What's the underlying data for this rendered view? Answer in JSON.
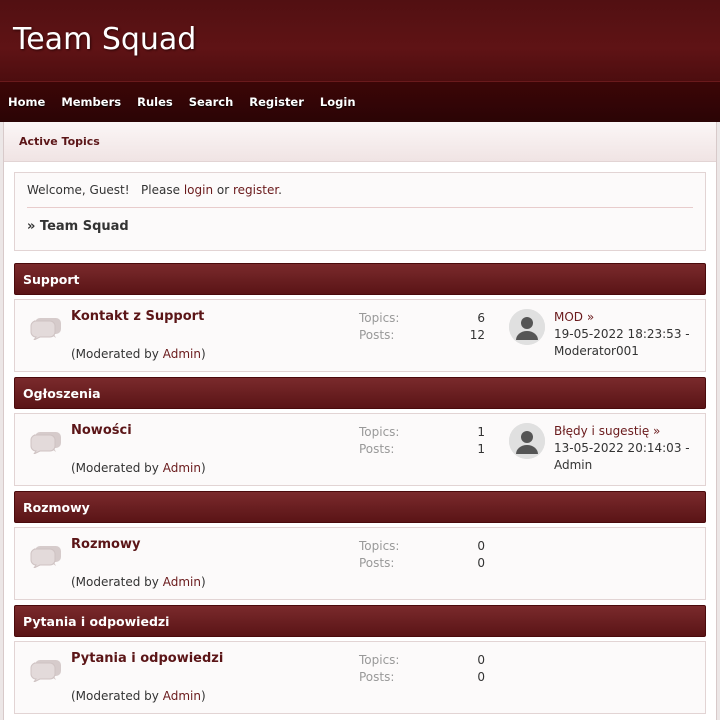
{
  "site": {
    "title": "Team Squad"
  },
  "nav": [
    "Home",
    "Members",
    "Rules",
    "Search",
    "Register",
    "Login"
  ],
  "breadcrumb_bar": {
    "active_topics": "Active Topics"
  },
  "welcome": {
    "greeting": "Welcome, Guest!",
    "please": "Please",
    "login": "login",
    "or": "or",
    "register": "register",
    "crumb": "» Team Squad"
  },
  "categories": [
    {
      "name": "Support",
      "board": {
        "name": "Kontakt z Support",
        "moderated_prefix": "(Moderated by ",
        "moderator": "Admin",
        "moderated_suffix": ")",
        "topics_label": "Topics:",
        "topics": "6",
        "posts_label": "Posts:",
        "posts": "12",
        "last_title": "MOD »",
        "last_date": "19-05-2022 18:23:53 -",
        "last_user": "Moderator001"
      }
    },
    {
      "name": "Ogłoszenia",
      "board": {
        "name": "Nowości",
        "moderated_prefix": "(Moderated by ",
        "moderator": "Admin",
        "moderated_suffix": ")",
        "topics_label": "Topics:",
        "topics": "1",
        "posts_label": "Posts:",
        "posts": "1",
        "last_title": "Błędy i sugestię »",
        "last_date": "13-05-2022 20:14:03 -",
        "last_user": "Admin"
      }
    },
    {
      "name": "Rozmowy",
      "board": {
        "name": "Rozmowy",
        "moderated_prefix": "(Moderated by ",
        "moderator": "Admin",
        "moderated_suffix": ")",
        "topics_label": "Topics:",
        "topics": "0",
        "posts_label": "Posts:",
        "posts": "0"
      }
    },
    {
      "name": "Pytania i odpowiedzi",
      "board": {
        "name": "Pytania i odpowiedzi",
        "moderated_prefix": "(Moderated by ",
        "moderator": "Admin",
        "moderated_suffix": ")",
        "topics_label": "Topics:",
        "topics": "0",
        "posts_label": "Posts:",
        "posts": "0"
      }
    }
  ]
}
